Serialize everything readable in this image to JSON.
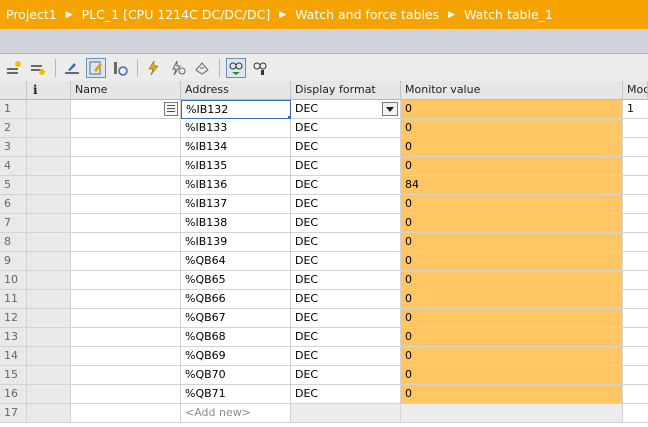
{
  "breadcrumb": [
    "Project1",
    "PLC_1 [CPU 1214C DC/DC/DC]",
    "Watch and force tables",
    "Watch table_1"
  ],
  "toolbar": {
    "icons": [
      "insert-row-icon",
      "add-row-icon",
      "rename-icon",
      "monitor-all-icon",
      "monitor-once-icon",
      "modify-now-icon",
      "modify-trigger-icon",
      "enable-periphery-icon",
      "show-modify-columns-icon",
      "show-force-columns-icon"
    ]
  },
  "table": {
    "headers": {
      "row_num": "",
      "info": "i",
      "name": "Name",
      "address": "Address",
      "display_format": "Display format",
      "monitor_value": "Monitor value",
      "modify": "Mod"
    },
    "rows": [
      {
        "num": "1",
        "name": "",
        "address": "%IB132",
        "format": "DEC",
        "value": "0",
        "modify": "1"
      },
      {
        "num": "2",
        "name": "",
        "address": "%IB133",
        "format": "DEC",
        "value": "0",
        "modify": ""
      },
      {
        "num": "3",
        "name": "",
        "address": "%IB134",
        "format": "DEC",
        "value": "0",
        "modify": ""
      },
      {
        "num": "4",
        "name": "",
        "address": "%IB135",
        "format": "DEC",
        "value": "0",
        "modify": ""
      },
      {
        "num": "5",
        "name": "",
        "address": "%IB136",
        "format": "DEC",
        "value": "84",
        "modify": ""
      },
      {
        "num": "6",
        "name": "",
        "address": "%IB137",
        "format": "DEC",
        "value": "0",
        "modify": ""
      },
      {
        "num": "7",
        "name": "",
        "address": "%IB138",
        "format": "DEC",
        "value": "0",
        "modify": ""
      },
      {
        "num": "8",
        "name": "",
        "address": "%IB139",
        "format": "DEC",
        "value": "0",
        "modify": ""
      },
      {
        "num": "9",
        "name": "",
        "address": "%QB64",
        "format": "DEC",
        "value": "0",
        "modify": ""
      },
      {
        "num": "10",
        "name": "",
        "address": "%QB65",
        "format": "DEC",
        "value": "0",
        "modify": ""
      },
      {
        "num": "11",
        "name": "",
        "address": "%QB66",
        "format": "DEC",
        "value": "0",
        "modify": ""
      },
      {
        "num": "12",
        "name": "",
        "address": "%QB67",
        "format": "DEC",
        "value": "0",
        "modify": ""
      },
      {
        "num": "13",
        "name": "",
        "address": "%QB68",
        "format": "DEC",
        "value": "0",
        "modify": ""
      },
      {
        "num": "14",
        "name": "",
        "address": "%QB69",
        "format": "DEC",
        "value": "0",
        "modify": ""
      },
      {
        "num": "15",
        "name": "",
        "address": "%QB70",
        "format": "DEC",
        "value": "0",
        "modify": ""
      },
      {
        "num": "16",
        "name": "",
        "address": "%QB71",
        "format": "DEC",
        "value": "0",
        "modify": ""
      }
    ],
    "add_row": {
      "num": "17",
      "placeholder": "<Add new>"
    }
  },
  "colors": {
    "breadcrumb_bg": "#f5a300",
    "monitor_bg": "#ffc663",
    "selection": "#3b6cb4"
  }
}
